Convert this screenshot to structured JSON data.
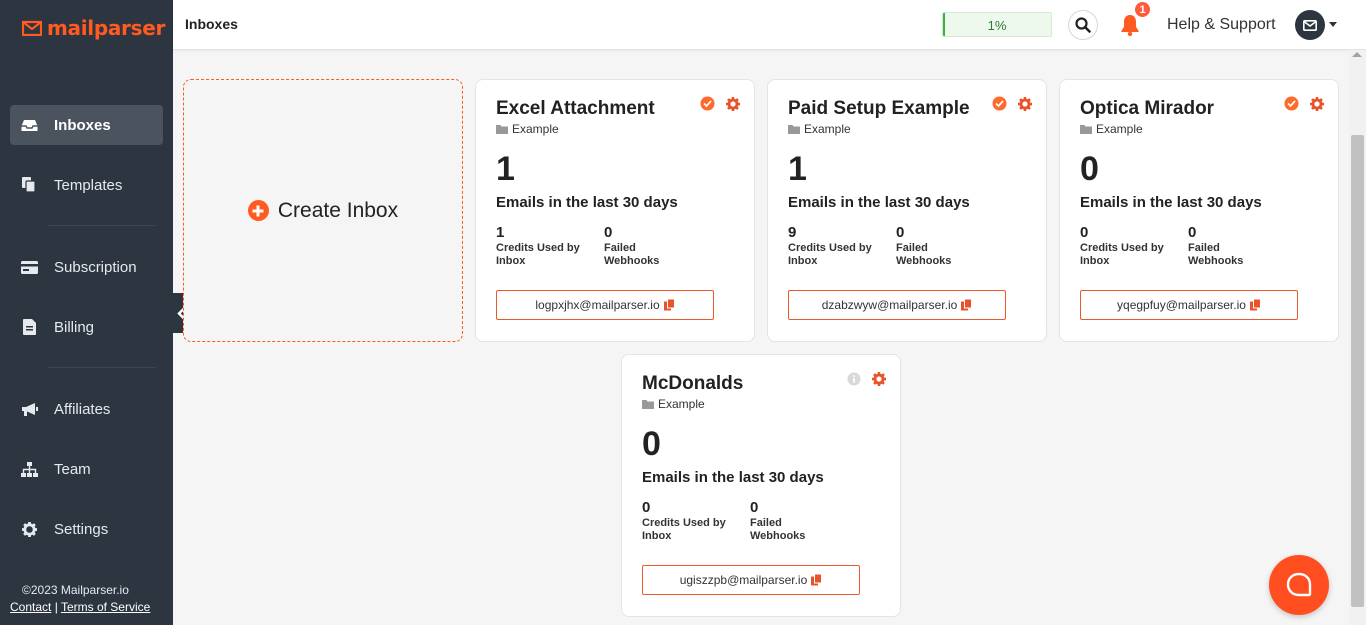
{
  "brand": {
    "name": "mailparser",
    "accent": "#ff5a1f"
  },
  "sidebar": {
    "items": [
      {
        "label": "Inboxes",
        "icon": "inbox-icon",
        "active": true
      },
      {
        "label": "Templates",
        "icon": "copy-icon"
      },
      {
        "label": "Subscription",
        "icon": "credit-card-icon"
      },
      {
        "label": "Billing",
        "icon": "file-invoice-icon"
      },
      {
        "label": "Affiliates",
        "icon": "megaphone-icon"
      },
      {
        "label": "Team",
        "icon": "sitemap-icon"
      },
      {
        "label": "Settings",
        "icon": "gear-icon"
      }
    ],
    "footer": {
      "copyright": "©2023 Mailparser.io",
      "contact": "Contact",
      "separator": "|",
      "terms": "Terms of Service"
    }
  },
  "header": {
    "title": "Inboxes",
    "usage_label": "1%",
    "usage_fraction": 0.01,
    "notification_count": "1",
    "help_label": "Help & Support"
  },
  "create_inbox": {
    "label": "Create Inbox"
  },
  "inboxes": [
    {
      "title": "Excel Attachment",
      "folder": "Example",
      "count": "1",
      "sub": "Emails in the last 30 days",
      "credits": "1",
      "credits_label": "Credits Used by Inbox",
      "failed": "0",
      "failed_label": "Failed Webhooks",
      "email": "logpxjhx@mailparser.io",
      "status": "ok"
    },
    {
      "title": "Paid Setup Example",
      "folder": "Example",
      "count": "1",
      "sub": "Emails in the last 30 days",
      "credits": "9",
      "credits_label": "Credits Used by Inbox",
      "failed": "0",
      "failed_label": "Failed Webhooks",
      "email": "dzabzwyw@mailparser.io",
      "status": "ok"
    },
    {
      "title": "Optica Mirador",
      "folder": "Example",
      "count": "0",
      "sub": "Emails in the last 30 days",
      "credits": "0",
      "credits_label": "Credits Used by Inbox",
      "failed": "0",
      "failed_label": "Failed Webhooks",
      "email": "yqegpfuy@mailparser.io",
      "status": "ok"
    },
    {
      "title": "McDonalds",
      "folder": "Example",
      "count": "0",
      "sub": "Emails in the last 30 days",
      "credits": "0",
      "credits_label": "Credits Used by Inbox",
      "failed": "0",
      "failed_label": "Failed Webhooks",
      "email": "ugiszzpb@mailparser.io",
      "status": "info"
    }
  ]
}
